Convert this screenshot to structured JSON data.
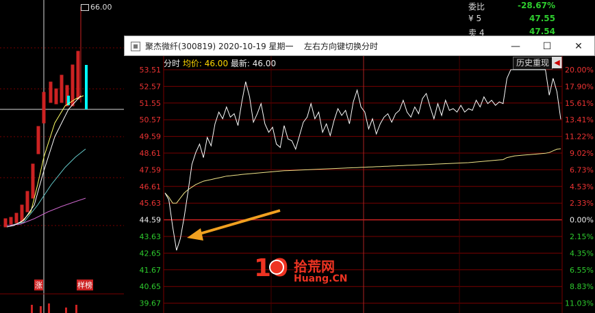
{
  "bg": {
    "top_label": "66.00",
    "bottom_labels": [
      "涨",
      "样榜"
    ],
    "right_panel": [
      {
        "label": "委比",
        "value": "-28.67%",
        "color": "#2ecc2e"
      },
      {
        "label": "¥ 5",
        "value": "47.55",
        "color": "#2ecc2e"
      },
      {
        "label": "卖 4",
        "value": "47.54",
        "color": "#2ecc2e"
      }
    ]
  },
  "window": {
    "title": "聚杰微纤(300819) 2020-10-19 星期一",
    "hint": "左右方向键切换分时",
    "buttons": {
      "minimize": "—",
      "maximize": "☐",
      "close": "✕"
    },
    "info": {
      "label": "分时",
      "avg_label": "均价:",
      "avg_value": "46.00",
      "latest_label": "最新:",
      "latest_value": "46.00"
    },
    "history_button": "历史重现",
    "back_button": "◀",
    "y_left": [
      "53.51",
      "52.57",
      "51.55",
      "50.57",
      "49.59",
      "48.61",
      "47.59",
      "46.61",
      "45.63",
      "44.59",
      "43.63",
      "42.65",
      "41.67",
      "40.65",
      "39.67"
    ],
    "y_right": [
      "20.00%",
      "17.90%",
      "15.61%",
      "13.41%",
      "11.22%",
      "9.02%",
      "6.73%",
      "4.53%",
      "2.33%",
      "0.00%",
      "2.15%",
      "4.35%",
      "6.55%",
      "8.83%",
      "11.03%"
    ],
    "watermark": {
      "num": "10",
      "cn": "拾荒网",
      "en": "Huang.CN"
    }
  },
  "colors": {
    "up": "#e33",
    "down": "#2ecc2e",
    "neutral": "#eee",
    "grid": "#7a0000",
    "avg_line": "#f2e68a",
    "price_line": "#ffffff",
    "arrow": "#f0a020"
  },
  "chart_data": {
    "type": "line",
    "title": "",
    "series": [
      {
        "name": "最新",
        "values": [
          46.2,
          45.8,
          44.2,
          42.8,
          43.5,
          44.8,
          46.3,
          47.9,
          48.6,
          49.1,
          48.3,
          49.5,
          49.0,
          50.3,
          51.0,
          50.6,
          51.3,
          50.7,
          50.9,
          50.2,
          51.6,
          52.8,
          51.9,
          50.4,
          50.9,
          51.5,
          50.3,
          49.8,
          50.1,
          49.1,
          48.9,
          50.2,
          49.4,
          49.3,
          48.8,
          49.6,
          50.4,
          50.7,
          51.5,
          50.6,
          51.0,
          49.8,
          50.3,
          49.6,
          50.5,
          51.2,
          50.8,
          51.1,
          50.3,
          51.6,
          52.3,
          51.3,
          51.0,
          50.0,
          50.6,
          49.7,
          50.3,
          50.7,
          50.9,
          50.4,
          50.9,
          51.1,
          51.7,
          51.0,
          50.7,
          51.3,
          50.9,
          51.8,
          52.1,
          51.3,
          50.6,
          51.5,
          50.8,
          51.7,
          51.1,
          51.2,
          51.0,
          51.4,
          51.0,
          51.2,
          51.1,
          51.7,
          51.3,
          51.9,
          51.5,
          51.7,
          51.4,
          51.6,
          51.5,
          53.0,
          53.51,
          53.51,
          53.51,
          53.51,
          53.51,
          53.51,
          53.51,
          53.51,
          53.51,
          53.51,
          52.0,
          53.0,
          52.2,
          50.57
        ]
      },
      {
        "name": "均价",
        "values": [
          46.2,
          45.95,
          45.6,
          45.6,
          45.9,
          46.2,
          46.4,
          46.55,
          46.7,
          46.8,
          46.9,
          46.95,
          47.0,
          47.05,
          47.1,
          47.15,
          47.2,
          47.22,
          47.25,
          47.27,
          47.3,
          47.32,
          47.34,
          47.36,
          47.38,
          47.4,
          47.42,
          47.44,
          47.46,
          47.48,
          47.5,
          47.52,
          47.53,
          47.54,
          47.55,
          47.56,
          47.57,
          47.58,
          47.59,
          47.6,
          47.61,
          47.62,
          47.63,
          47.64,
          47.65,
          47.66,
          47.67,
          47.68,
          47.69,
          47.7,
          47.71,
          47.72,
          47.73,
          47.74,
          47.75,
          47.76,
          47.77,
          47.78,
          47.79,
          47.8,
          47.81,
          47.82,
          47.83,
          47.84,
          47.85,
          47.86,
          47.87,
          47.88,
          47.89,
          47.9,
          47.91,
          47.92,
          47.93,
          47.94,
          47.95,
          47.96,
          47.97,
          47.98,
          47.99,
          48.0,
          48.02,
          48.04,
          48.06,
          48.08,
          48.1,
          48.12,
          48.14,
          48.16,
          48.18,
          48.3,
          48.35,
          48.4,
          48.42,
          48.44,
          48.46,
          48.48,
          48.5,
          48.52,
          48.54,
          48.56,
          48.6,
          48.7,
          48.8,
          48.82
        ]
      }
    ],
    "ylim": [
      39.67,
      53.51
    ],
    "yticks_left": [
      "53.51",
      "52.57",
      "51.55",
      "50.57",
      "49.59",
      "48.61",
      "47.59",
      "46.61",
      "45.63",
      "44.59",
      "43.63",
      "42.65",
      "41.67",
      "40.65",
      "39.67"
    ],
    "yticks_right": [
      "20.00%",
      "17.90%",
      "15.61%",
      "13.41%",
      "11.22%",
      "9.02%",
      "6.73%",
      "4.53%",
      "2.33%",
      "0.00%",
      "2.15%",
      "4.35%",
      "6.55%",
      "8.83%",
      "11.03%"
    ],
    "base_price": 44.59,
    "grid": true
  }
}
